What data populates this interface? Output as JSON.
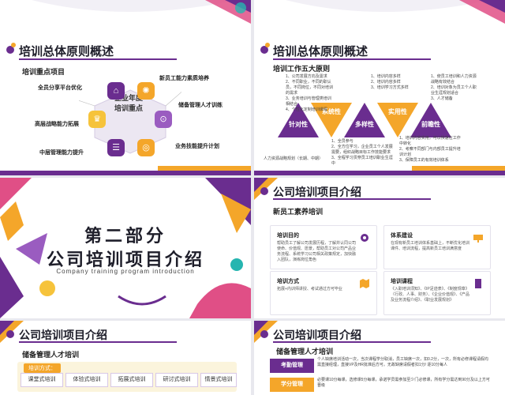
{
  "colors": {
    "purple": "#6a2d8f",
    "purple_light": "#9a5cc0",
    "orange": "#f4a62a",
    "yellow": "#f6c33b",
    "pink": "#e04f86",
    "teal": "#26b5b0"
  },
  "slide1": {
    "title": "培训总体原则概述",
    "subtitle": "培训重点项目",
    "center": [
      "企业年度",
      "培训重点"
    ],
    "nodes": [
      {
        "label": "全员分享平台优化",
        "icon": "tag-icon"
      },
      {
        "label": "新员工能力素质培养",
        "icon": "lightbulb-icon"
      },
      {
        "label": "高层战略能力拓展",
        "icon": "trophy-icon"
      },
      {
        "label": "储备管理人才训练",
        "icon": "magnify-icon"
      },
      {
        "label": "中层管理能力提升",
        "icon": "hand-icon"
      },
      {
        "label": "业务技能提升计划",
        "icon": "target-icon"
      }
    ]
  },
  "slide2": {
    "title": "培训总体原则概述",
    "subtitle": "培训工作五大原则",
    "principles": [
      "针对性",
      "系统性",
      "多样性",
      "实用性",
      "前瞻性"
    ],
    "notes_top": [
      [
        "1、公司发展方向及需求",
        "2、不同职业，不同的职认员，不同岗位，不同对培训的需求",
        "3、业务培训与管理类培训相结合",
        "4、个性化定制培训课程"
      ],
      [
        "1、培训内容多样",
        "2、培训内容多样",
        "3、培训学习方式多样"
      ],
      [
        "1、使员工培训和人力资源战略有效结合",
        "2、培训对象为员工个人职业生涯规划适合",
        "3、人才储备"
      ]
    ],
    "notes_bottom": [
      [
        "1、全员参与",
        "2、全方位学习，企业员工个人发展需要，组织战略目标工作技能要求",
        "3、全程学习贯穿员工培训职业生涯中"
      ],
      [
        "1、培训内容实用，可以快速在工作中转化",
        "2、考察不同部门与内部员工提升培训计划",
        "3、保障员工的有效培训体系"
      ]
    ],
    "left_note": "人力资源战略规划（长期、中期）"
  },
  "slide3": {
    "part": "第二部分",
    "title": "公司培训项目介绍",
    "en": "Company training program introduction"
  },
  "slide4": {
    "title": "公司培训项目介绍",
    "subtitle": "新员工素养培训",
    "cards": [
      {
        "title": "培训目的",
        "text": "帮助员工了解公司发展历程，了解并认同公司使命、价值观、愿景，帮助员工对公司产品业务流程、系统学习公司相关政策规定，加快融入团队，演练岗位角色",
        "icon": "gear-icon"
      },
      {
        "title": "体系建设",
        "text": "在现有新员工培训体系基础上，不断优化培训课件、培训流程，提高新员工培训满意度",
        "icon": "presentation-icon"
      },
      {
        "title": "培训方式",
        "text": "拓展+内训师讲授、考试通过方可毕业",
        "icon": "map-icon"
      },
      {
        "title": "培训课程",
        "text": "《入职培训须知》、《IP足迹表》、《制度规章》（行政、人事、财务）、《企业价值观》、《产品及业务流程介绍》、《职业发展规划》",
        "icon": "sd-card-icon"
      }
    ]
  },
  "slide5": {
    "title": "公司培训项目介绍",
    "subtitle": "储备管理人才培训",
    "method_label": "培训方式：",
    "steps": [
      "课堂式培训",
      "体验式培训",
      "拓展式培训",
      "研讨式培训",
      "情景式培训"
    ]
  },
  "slide6": {
    "title": "公司培训项目介绍",
    "subtitle": "储备管理人才培训",
    "rows": [
      {
        "tag": "考勤管理",
        "text": "个人缺席培训活动一次，当次课程学分取消，员工缺席一次，扣0.2分，一次，所有必修课程请假均需直接经理，直接VP及HR批准后方可。无故缺席请假者扣1分/ 逐10分每人"
      },
      {
        "tag": "学分管理",
        "text": "必要课10分每课，选修课5分每课，承诺学员需参加至少门必修课，所有学分需达到90分及以上方可晋级"
      }
    ]
  }
}
